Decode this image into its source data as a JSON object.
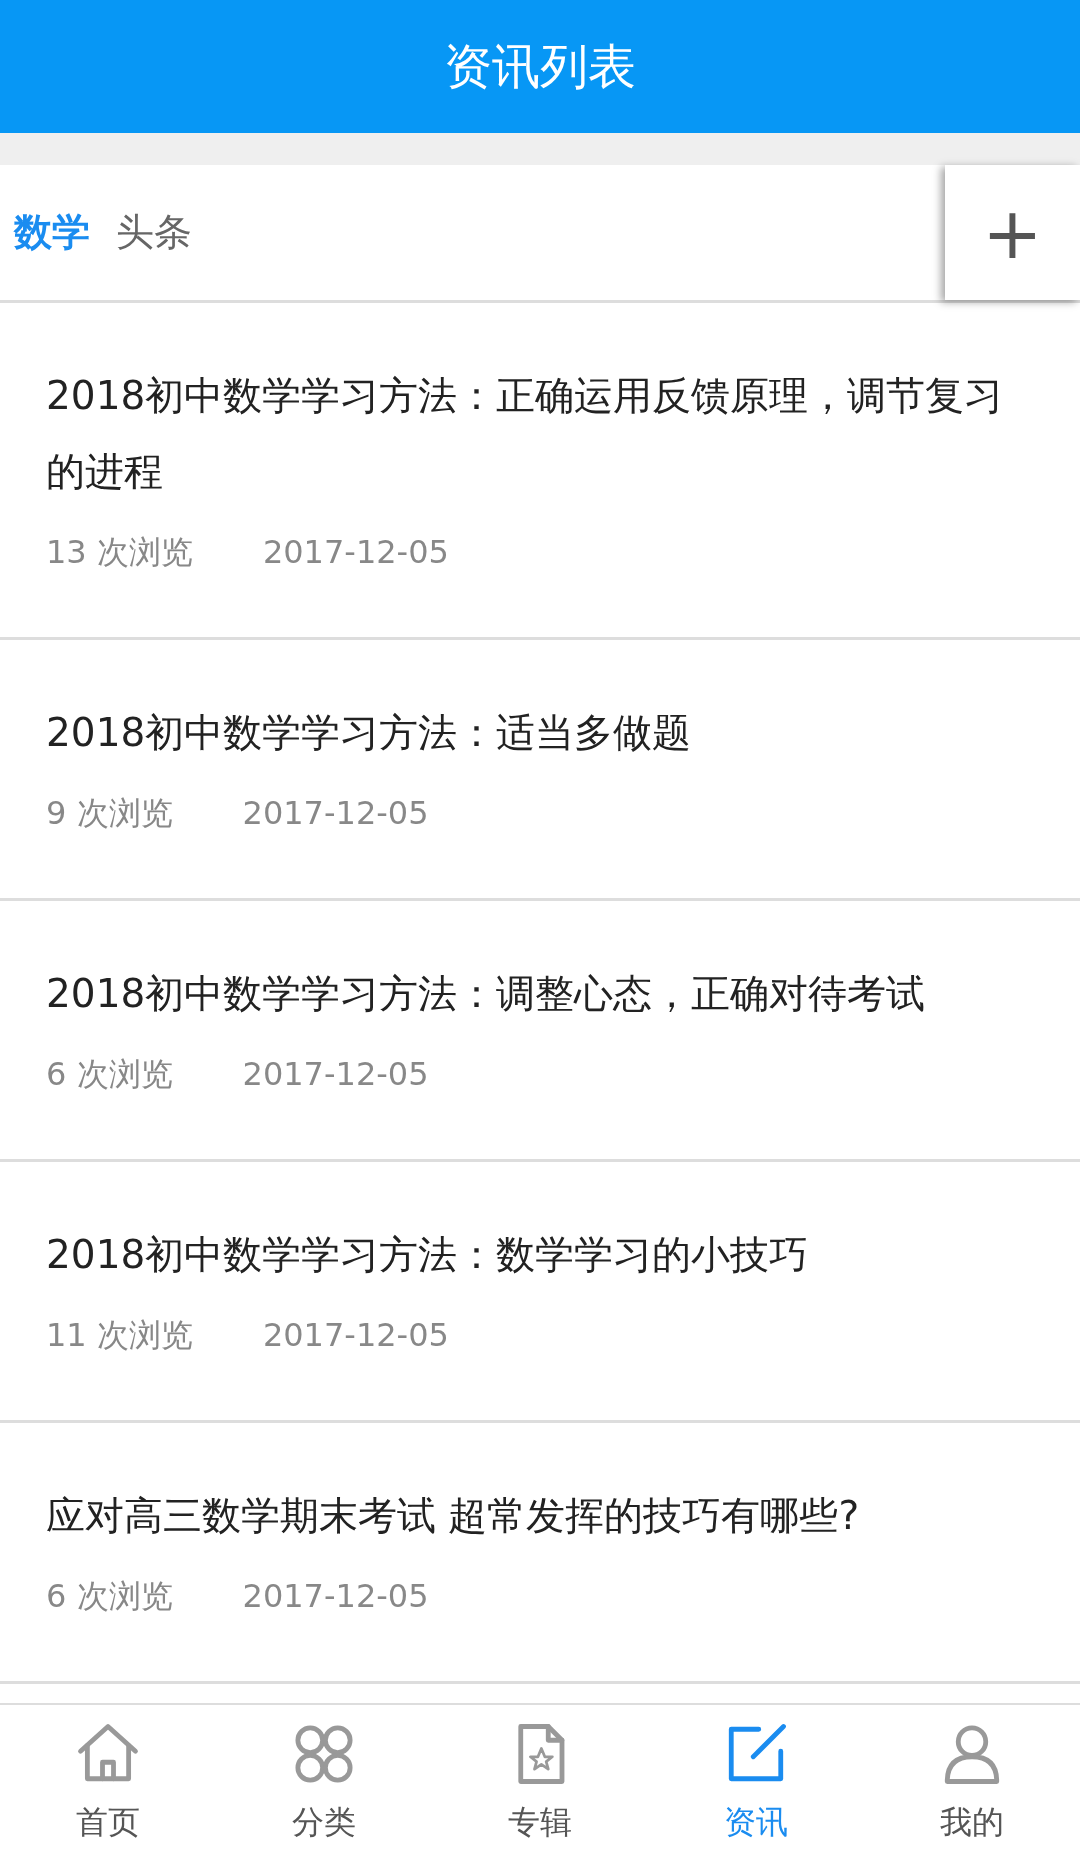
{
  "header": {
    "title": "资讯列表"
  },
  "tabs": [
    {
      "label": "数学",
      "selected": true
    },
    {
      "label": "头条",
      "selected": false
    }
  ],
  "add_button": {
    "label": "+"
  },
  "articles": [
    {
      "title": "2018初中数学学习方法：正确运用反馈原理，调节复习的进程",
      "views": "13 次浏览",
      "date": "2017-12-05"
    },
    {
      "title": "2018初中数学学习方法：适当多做题",
      "views": "9 次浏览",
      "date": "2017-12-05"
    },
    {
      "title": "2018初中数学学习方法：调整心态，正确对待考试",
      "views": "6 次浏览",
      "date": "2017-12-05"
    },
    {
      "title": "2018初中数学学习方法：数学学习的小技巧",
      "views": "11 次浏览",
      "date": "2017-12-05"
    },
    {
      "title": "应对高三数学期末考试 超常发挥的技巧有哪些?",
      "views": "6 次浏览",
      "date": "2017-12-05"
    }
  ],
  "nav": [
    {
      "label": "首页",
      "selected": false
    },
    {
      "label": "分类",
      "selected": false
    },
    {
      "label": "专辑",
      "selected": false
    },
    {
      "label": "资讯",
      "selected": true
    },
    {
      "label": "我的",
      "selected": false
    }
  ]
}
